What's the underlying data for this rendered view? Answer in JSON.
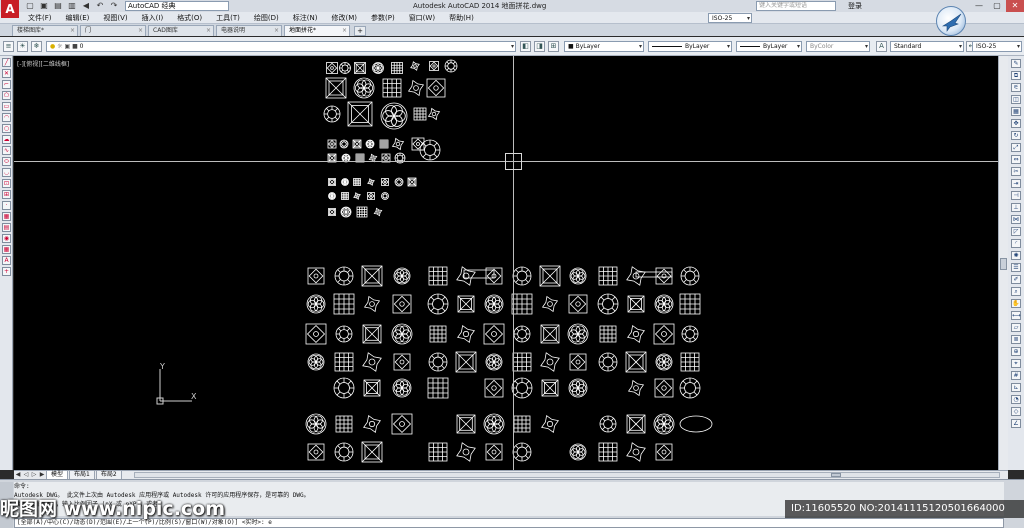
{
  "titlebar": {
    "logo": "A",
    "quick_access": [
      "▢",
      "▣",
      "▤",
      "▥",
      "◀",
      "↶",
      "↷",
      "▾"
    ],
    "workspace": "AutoCAD 经典",
    "title": "Autodesk AutoCAD 2014    地面拼花.dwg",
    "search_placeholder": "键入关键字或短语",
    "login": "登录",
    "window_buttons": [
      "—",
      "▢",
      "✕"
    ]
  },
  "menu": [
    "文件(F)",
    "编辑(E)",
    "视图(V)",
    "插入(I)",
    "格式(O)",
    "工具(T)",
    "绘图(D)",
    "标注(N)",
    "修改(M)",
    "参数(P)",
    "窗口(W)",
    "帮助(H)"
  ],
  "doc_tabs": [
    {
      "label": "楼梯图库*",
      "active": false
    },
    {
      "label": "门",
      "active": false
    },
    {
      "label": "CAD图库",
      "active": false
    },
    {
      "label": "电器说明",
      "active": false
    },
    {
      "label": "地面拼花*",
      "active": true
    }
  ],
  "toolbar": {
    "layer": "0",
    "color": "ByLayer",
    "linetype": "ByLayer",
    "lineweight": "ByLayer",
    "plotstyle": "ByColor",
    "text_style": "Standard",
    "dim_style": "ISO-25",
    "dim_style_top": "ISO-25"
  },
  "canvas": {
    "viewport_label": "[-][俯视][二维线框]",
    "ucs_x": "X",
    "ucs_y": "Y"
  },
  "layout_tabs": [
    {
      "label": "模型",
      "active": true
    },
    {
      "label": "布局1",
      "active": false
    },
    {
      "label": "布局2",
      "active": false
    }
  ],
  "command": {
    "history": [
      "命令:",
      "Autodesk DWG。  此文件上次由 Autodesk 应用程序或 Autodesk 许可的应用程序保存，是可靠的 DWG。",
      "指定窗口的角点，输入比例因子 (nX 或 nXP)，或者"
    ],
    "prompt": "[全部(A)/中心(C)/动态(D)/范围(E)/上一个(P)/比例(S)/窗口(W)/对象(O)] <实时>:  e"
  },
  "watermark": {
    "left": "昵图网 www.nipic.com",
    "right": "ID:11605520 NO:20141115120501664000"
  },
  "colors": {
    "canvas": "#000000",
    "crosshair": "#bdbdbd",
    "drawing": "#ffffff",
    "logo": "#c81d25"
  }
}
